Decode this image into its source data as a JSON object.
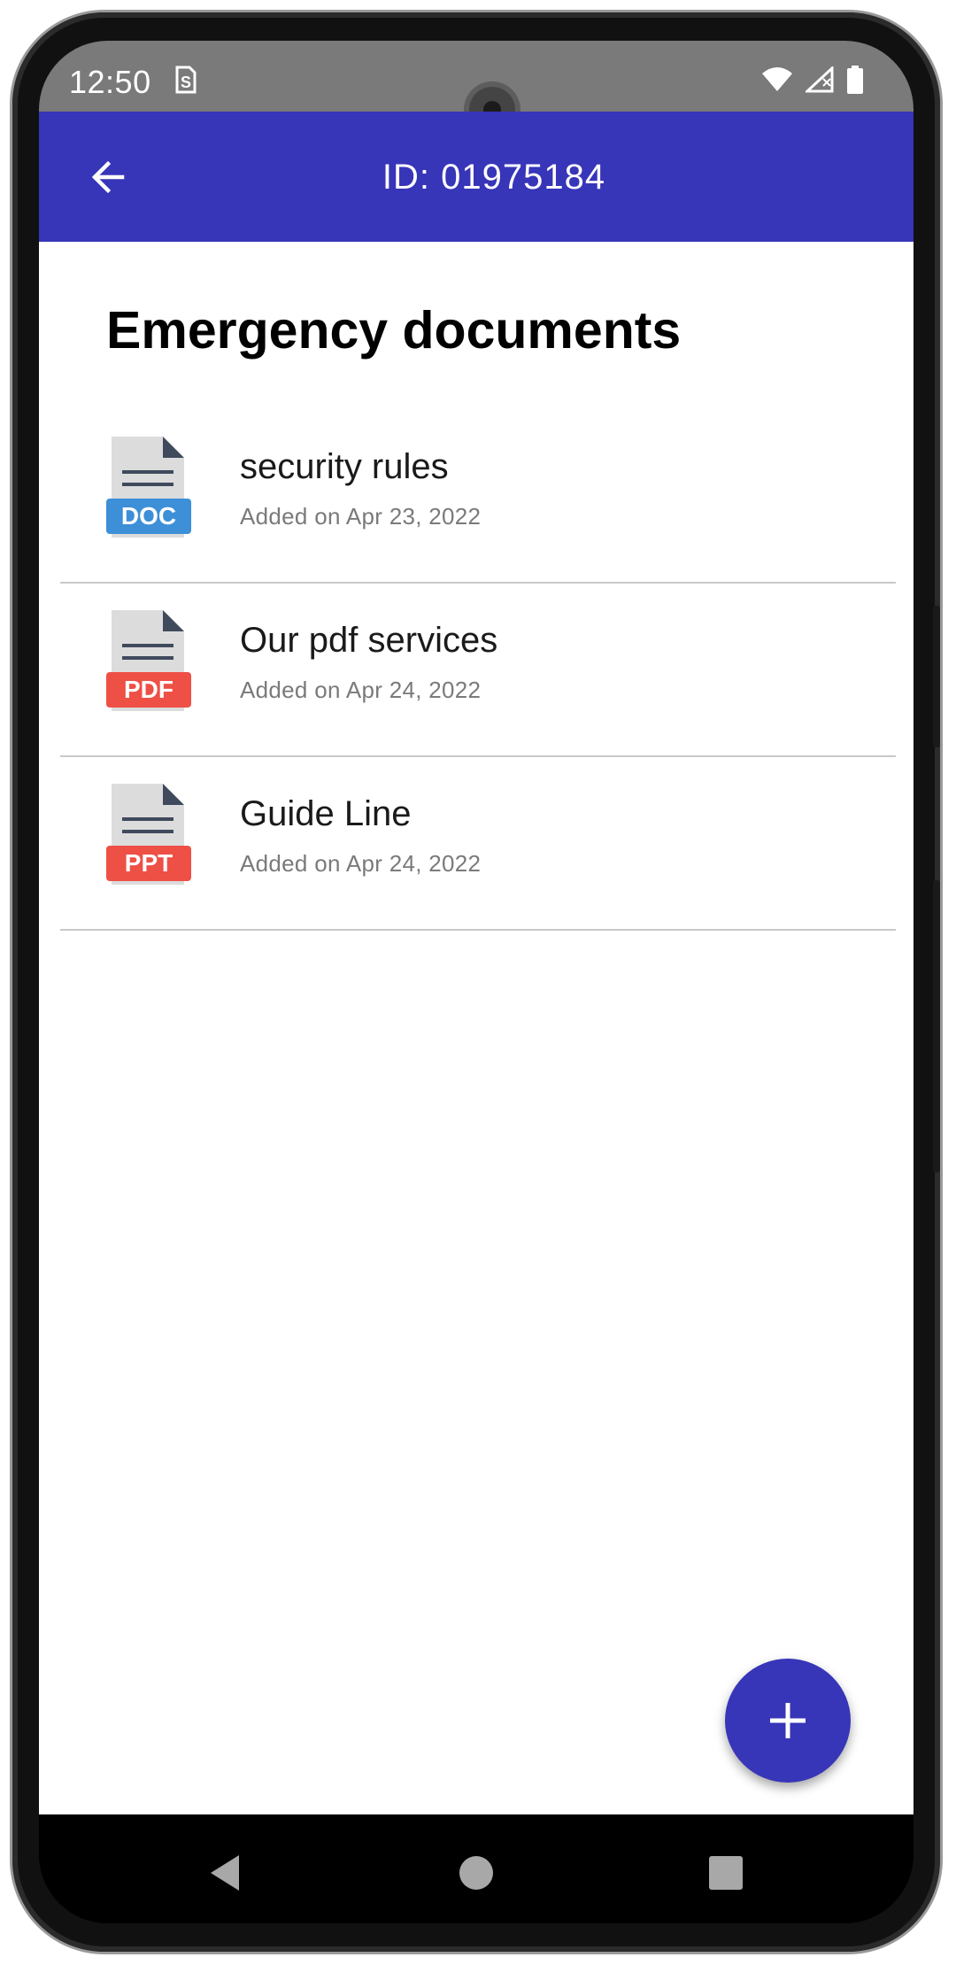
{
  "status_bar": {
    "time": "12:50",
    "sim_icon": "sim-s-icon",
    "icons": [
      "wifi-icon",
      "cell-signal-icon",
      "battery-icon"
    ]
  },
  "app_bar": {
    "title": "ID: 01975184",
    "back_icon": "arrow-left-icon",
    "color": "#3735b8"
  },
  "main": {
    "section_title": "Emergency documents",
    "documents": [
      {
        "name": "security rules",
        "date": "Added on Apr 23, 2022",
        "type": "DOC",
        "badge_color": "#3d8fd8"
      },
      {
        "name": "Our pdf services",
        "date": "Added on Apr 24, 2022",
        "type": "PDF",
        "badge_color": "#ee5046"
      },
      {
        "name": "Guide Line",
        "date": "Added on Apr 24, 2022",
        "type": "PPT",
        "badge_color": "#ee5046"
      }
    ]
  },
  "fab": {
    "icon": "plus-icon",
    "color": "#3735b8"
  },
  "nav_bar": {
    "icons": [
      "nav-back-icon",
      "nav-home-icon",
      "nav-recents-icon"
    ]
  }
}
